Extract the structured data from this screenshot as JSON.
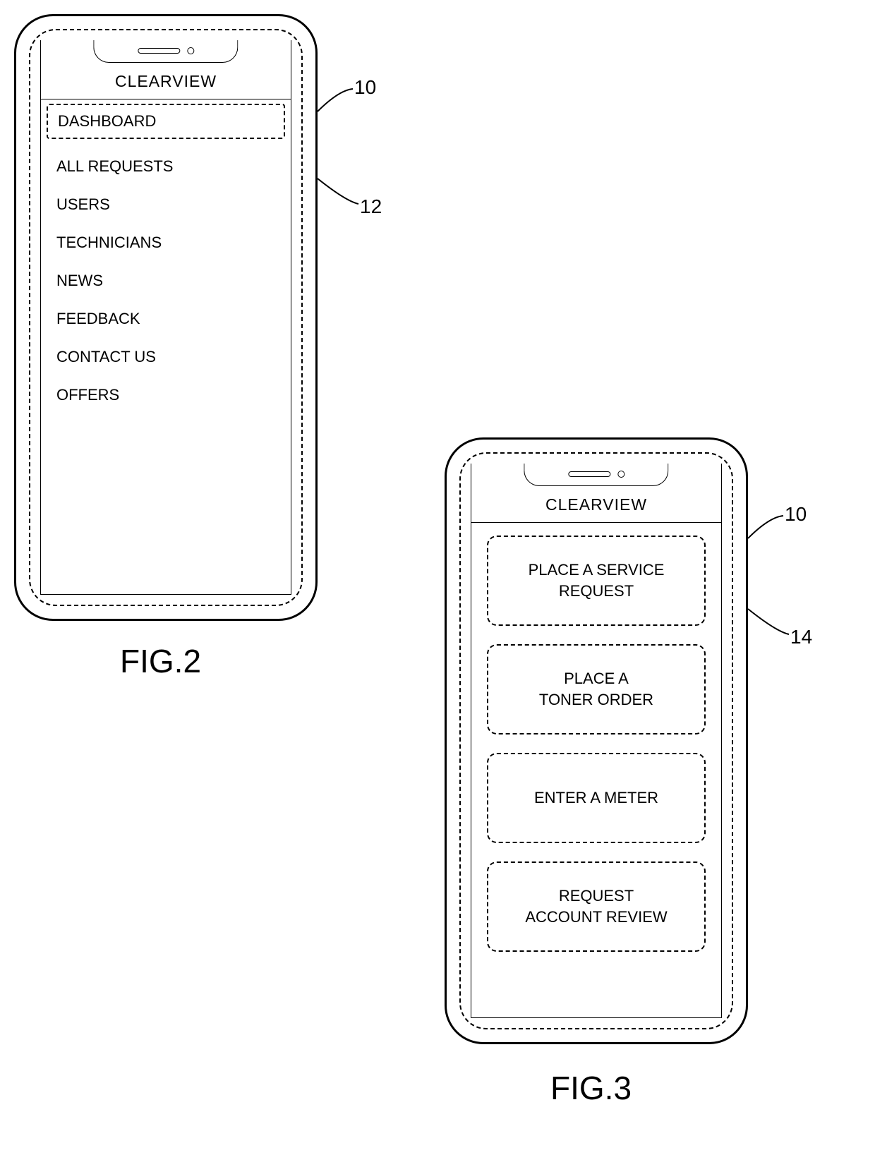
{
  "fig2": {
    "caption": "FIG.2",
    "app_title": "CLEARVIEW",
    "callouts": {
      "phone": "10",
      "menu": "12"
    },
    "menu": {
      "selected": "DASHBOARD",
      "items": [
        "ALL REQUESTS",
        "USERS",
        "TECHNICIANS",
        "NEWS",
        "FEEDBACK",
        "CONTACT US",
        "OFFERS"
      ]
    }
  },
  "fig3": {
    "caption": "FIG.3",
    "app_title": "CLEARVIEW",
    "callouts": {
      "phone": "10",
      "tiles": "14"
    },
    "tiles": [
      "PLACE A SERVICE\nREQUEST",
      "PLACE A\nTONER ORDER",
      "ENTER A METER",
      "REQUEST\nACCOUNT REVIEW"
    ]
  }
}
